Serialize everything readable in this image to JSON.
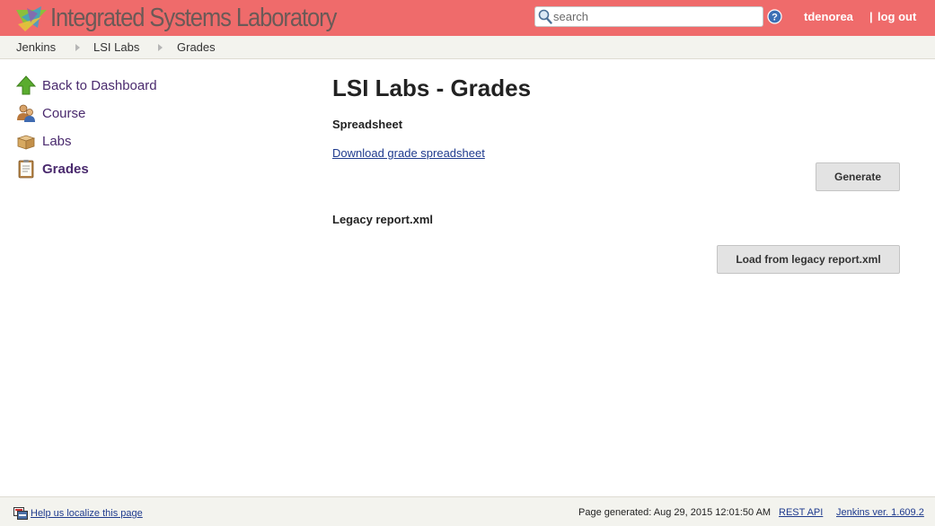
{
  "header": {
    "title": "Integrated Systems Laboratory",
    "search_placeholder": "search",
    "search_value": "",
    "user": "tdenorea",
    "separator": "|",
    "logout": "log out",
    "background_color": "#ef6b6b"
  },
  "breadcrumb": {
    "items": [
      "Jenkins",
      "LSI Labs",
      "Grades"
    ]
  },
  "sidebar": {
    "items": [
      {
        "label": "Back to Dashboard",
        "icon": "up-arrow-icon"
      },
      {
        "label": "Course",
        "icon": "people-icon"
      },
      {
        "label": "Labs",
        "icon": "box-icon"
      },
      {
        "label": "Grades",
        "icon": "clipboard-icon",
        "active": true
      }
    ]
  },
  "main": {
    "title": "LSI Labs - Grades",
    "spreadsheet_heading": "Spreadsheet",
    "download_link": "Download grade spreadsheet",
    "generate_button": "Generate",
    "legacy_heading": "Legacy report.xml",
    "legacy_button": "Load from legacy report.xml"
  },
  "footer": {
    "localize": "Help us localize this page",
    "generated": "Page generated: Aug 29, 2015 12:01:50 AM",
    "rest_api": "REST API",
    "version": "Jenkins ver. 1.609.2"
  }
}
